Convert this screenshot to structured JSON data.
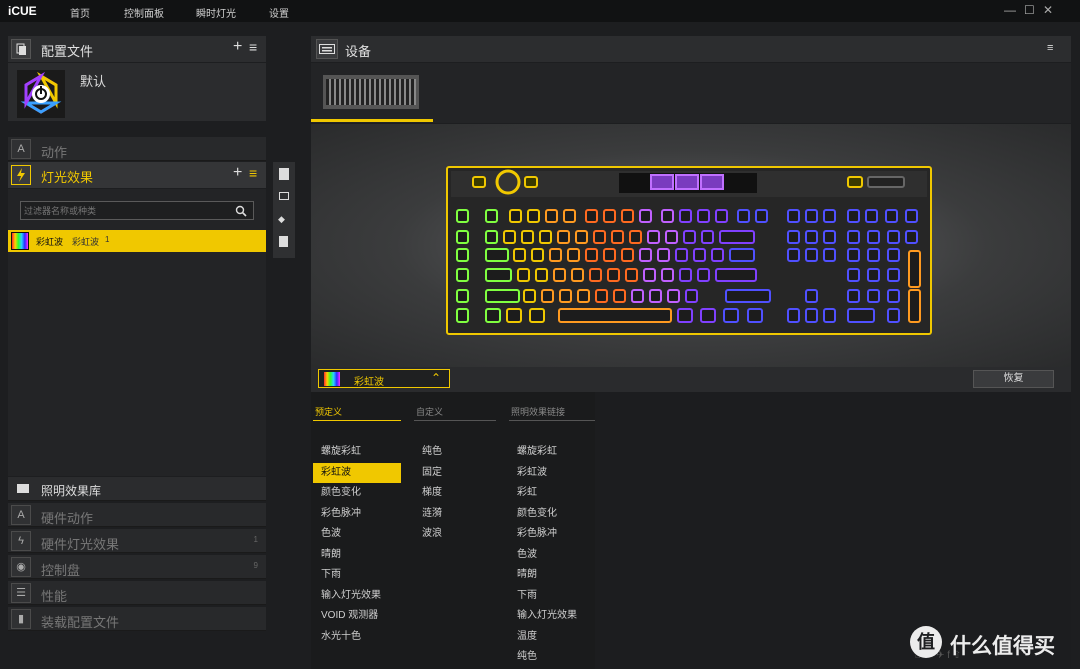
{
  "app": {
    "logo": "iCUE",
    "nav": [
      "首页",
      "控制面板",
      "瞬时灯光",
      "设置"
    ]
  },
  "window_controls": [
    "—",
    "☐",
    "✕"
  ],
  "profiles": {
    "title": "配置文件",
    "default_name": "默认"
  },
  "sections": {
    "actions": "动作",
    "lighting": "灯光效果"
  },
  "filter": {
    "placeholder": "过滤器名称或种类"
  },
  "effect_item": {
    "name": "彩虹波",
    "sub": "彩虹波",
    "count": "1"
  },
  "library": {
    "title": "照明效果库",
    "items": [
      {
        "label": "硬件动作",
        "count": ""
      },
      {
        "label": "硬件灯光效果",
        "count": "1"
      },
      {
        "label": "控制盘",
        "count": "9"
      },
      {
        "label": "性能",
        "count": ""
      },
      {
        "label": "装载配置文件",
        "count": ""
      }
    ]
  },
  "devices": {
    "title": "设备"
  },
  "effect_bar": {
    "selected": "彩虹波",
    "restore": "恢复"
  },
  "menu": {
    "predefined": {
      "header": "预定义",
      "items": [
        "螺旋彩虹",
        "彩虹波",
        "颜色变化",
        "彩色脉冲",
        "色波",
        "晴朗",
        "下雨",
        "输入灯光效果",
        "VOID 观测器",
        "水光十色"
      ],
      "selected": 1
    },
    "custom": {
      "header": "自定义",
      "items": [
        "纯色",
        "固定",
        "梯度",
        "涟漪",
        "波浪"
      ]
    },
    "link": {
      "header": "照明效果链接",
      "items": [
        "螺旋彩虹",
        "彩虹波",
        "彩虹",
        "颜色变化",
        "彩色脉冲",
        "色波",
        "晴朗",
        "下雨",
        "输入灯光效果",
        "温度",
        "纯色"
      ]
    }
  },
  "watermark": {
    "glyph": "值",
    "text": "什么值得买"
  },
  "colors": {
    "accent": "#f0c800",
    "panel": "#2c2d2f",
    "bg": "#1d1e20"
  }
}
